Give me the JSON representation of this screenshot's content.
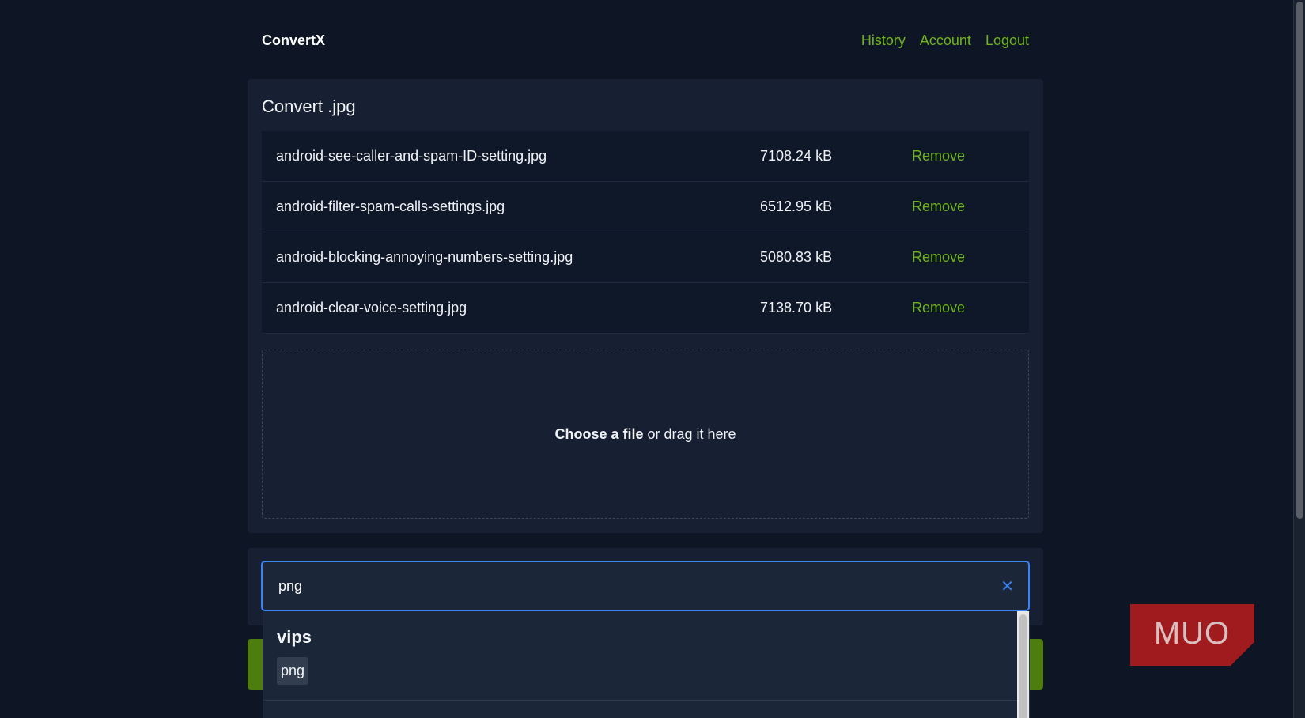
{
  "header": {
    "brand": "ConvertX",
    "nav": [
      {
        "label": "History"
      },
      {
        "label": "Account"
      },
      {
        "label": "Logout"
      }
    ]
  },
  "convert": {
    "title": "Convert .jpg",
    "files": [
      {
        "name": "android-see-caller-and-spam-ID-setting.jpg",
        "size": "7108.24 kB",
        "action": "Remove"
      },
      {
        "name": "android-filter-spam-calls-settings.jpg",
        "size": "6512.95 kB",
        "action": "Remove"
      },
      {
        "name": "android-blocking-annoying-numbers-setting.jpg",
        "size": "5080.83 kB",
        "action": "Remove"
      },
      {
        "name": "android-clear-voice-setting.jpg",
        "size": "7138.70 kB",
        "action": "Remove"
      }
    ],
    "dropzone": {
      "choose_label": "Choose a file",
      "rest_label": "or drag it here"
    }
  },
  "search": {
    "value": "png",
    "clear_icon": "close-icon"
  },
  "dropdown": {
    "group_label": "vips",
    "option_label": "png"
  },
  "watermark": {
    "text": "MUO"
  },
  "colors": {
    "background": "#0e1525",
    "card": "#162032",
    "accent_link": "#6fb31c",
    "focus_border": "#3b82f6",
    "convert_button": "#4d7c0f",
    "watermark_red": "#b91c1c"
  }
}
